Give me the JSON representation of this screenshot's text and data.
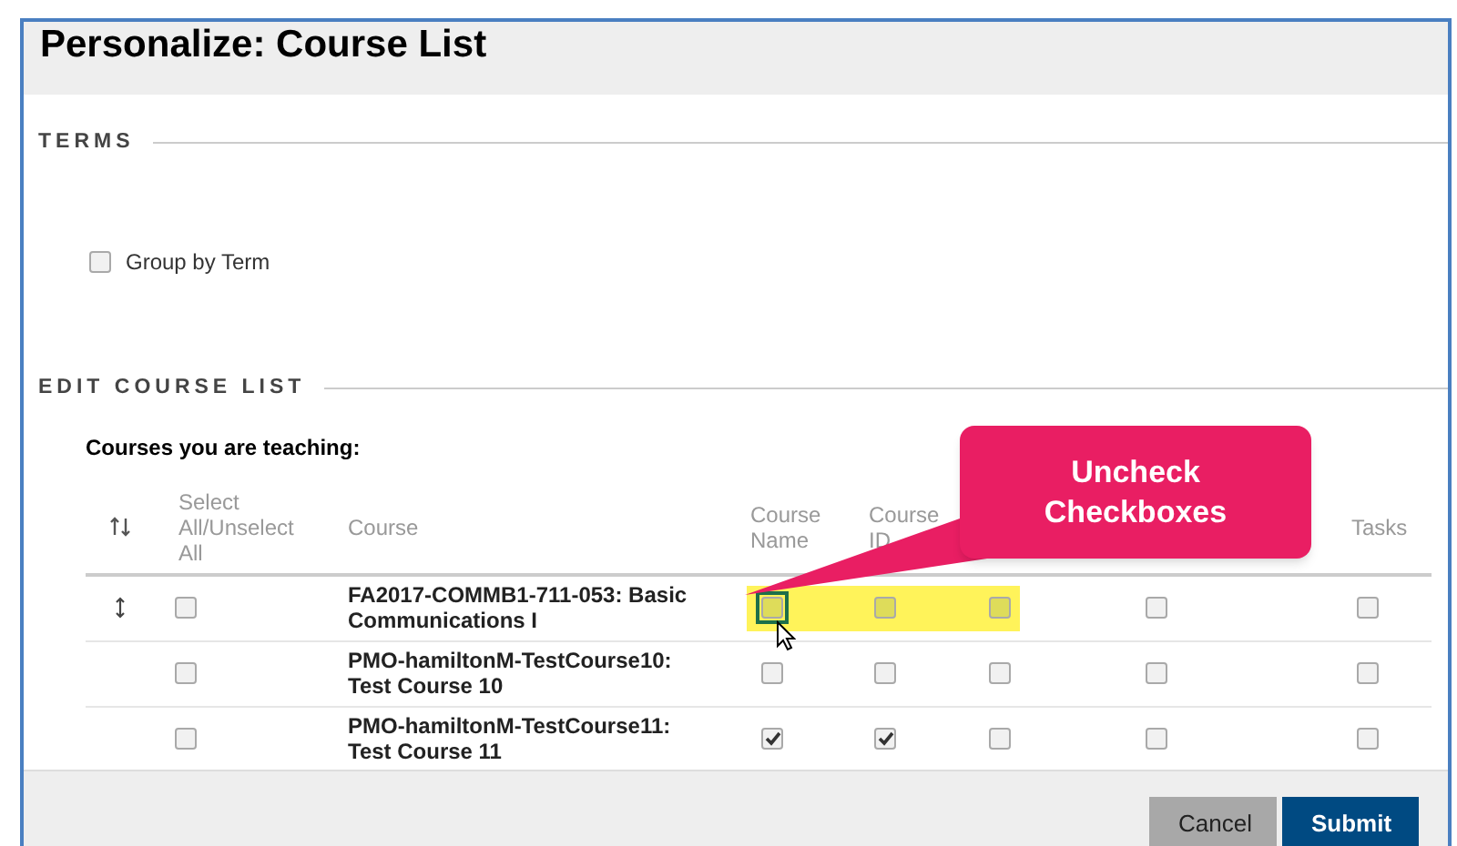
{
  "title": "Personalize: Course List",
  "terms": {
    "heading": "TERMS",
    "group_by_term": {
      "label": "Group by Term",
      "checked": false
    }
  },
  "edit_course_list": {
    "heading": "EDIT COURSE LIST",
    "subheading": "Courses you are teaching:",
    "columns": [
      {
        "kind": "sort"
      },
      {
        "label": "Select All/Unselect All"
      },
      {
        "label": "Course"
      },
      {
        "label": "Course Name"
      },
      {
        "label": "Course ID"
      },
      {},
      {},
      {
        "label": "Tasks"
      }
    ],
    "rows": [
      {
        "drag_handle": true,
        "highlighted": true,
        "course": "FA2017-COMMB1-711-053: Basic Communications I",
        "checkboxes": [
          {
            "checked": false
          },
          {
            "checked": false
          },
          {
            "checked": false
          },
          {
            "checked": false
          },
          {
            "checked": false
          },
          {
            "checked": false
          }
        ]
      },
      {
        "drag_handle": false,
        "highlighted": false,
        "course": "PMO-hamiltonM-TestCourse10: Test Course 10",
        "checkboxes": [
          {
            "checked": false
          },
          {
            "checked": false
          },
          {
            "checked": false
          },
          {
            "checked": false
          },
          {
            "checked": false
          },
          {
            "checked": false
          }
        ]
      },
      {
        "drag_handle": false,
        "highlighted": false,
        "course": "PMO-hamiltonM-TestCourse11: Test Course 11",
        "checkboxes": [
          {
            "checked": false
          },
          {
            "checked": true
          },
          {
            "checked": true
          },
          {
            "checked": false
          },
          {
            "checked": false
          },
          {
            "checked": false
          }
        ]
      }
    ]
  },
  "callout": {
    "lines": [
      "Uncheck",
      "Checkboxes"
    ]
  },
  "buttons": [
    {
      "label": "Cancel",
      "kind": "secondary"
    },
    {
      "label": "Submit",
      "kind": "primary"
    }
  ]
}
